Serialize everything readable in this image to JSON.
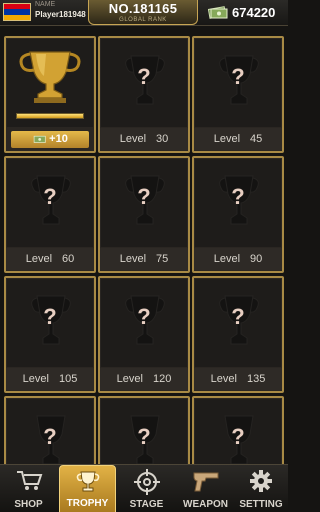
{
  "header": {
    "flag_colors": [
      "#d90012",
      "#0033a0",
      "#f2a800"
    ],
    "name_label": "NAME",
    "player_name": "Player181948",
    "rank_value": "NO.181165",
    "rank_label": "GLOBAL RANK",
    "cash_icon": "cash-icon",
    "cash_amount": "674220"
  },
  "trophies": [
    {
      "state": "unlocked",
      "progress": 1.0,
      "reward": "+10"
    },
    {
      "state": "locked",
      "level_word": "Level",
      "level": "30"
    },
    {
      "state": "locked",
      "level_word": "Level",
      "level": "45"
    },
    {
      "state": "locked",
      "level_word": "Level",
      "level": "60"
    },
    {
      "state": "locked",
      "level_word": "Level",
      "level": "75"
    },
    {
      "state": "locked",
      "level_word": "Level",
      "level": "90"
    },
    {
      "state": "locked",
      "level_word": "Level",
      "level": "105"
    },
    {
      "state": "locked",
      "level_word": "Level",
      "level": "120"
    },
    {
      "state": "locked",
      "level_word": "Level",
      "level": "135"
    },
    {
      "state": "locked"
    },
    {
      "state": "locked"
    },
    {
      "state": "locked"
    }
  ],
  "locked_mark": "?",
  "nav": {
    "tabs": [
      {
        "label": "SHOP",
        "icon": "cart-icon"
      },
      {
        "label": "TROPHY",
        "icon": "trophy-icon",
        "active": true
      },
      {
        "label": "STAGE",
        "icon": "crosshair-icon"
      },
      {
        "label": "WEAPON",
        "icon": "pistol-icon"
      },
      {
        "label": "SETTING",
        "icon": "gear-icon"
      }
    ]
  },
  "colors": {
    "accent": "#d9a63a",
    "card_border": "#a88a45",
    "background": "#151412"
  }
}
